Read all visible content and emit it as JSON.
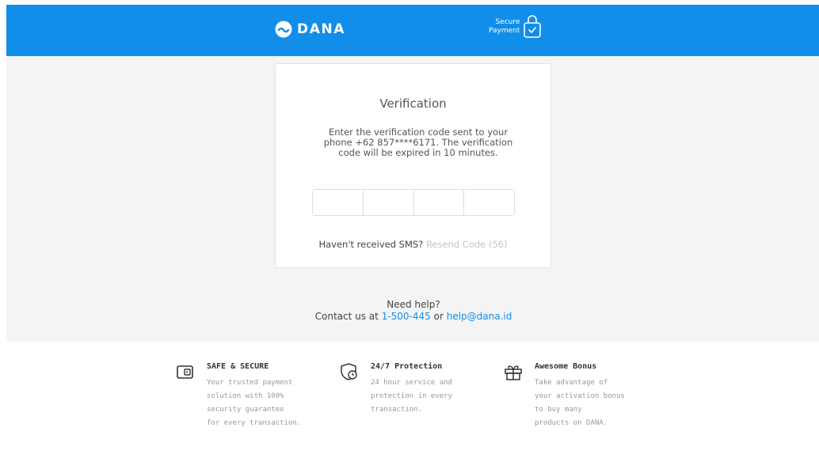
{
  "header": {
    "logo_text": "DANA",
    "secure_line1": "Secure",
    "secure_line2": "Payment",
    "bg_color": "#118eea"
  },
  "verification": {
    "title": "Verification",
    "description": "Enter the verification code sent to your phone +62 857****6171. The verification code will be expired in 10 minutes.",
    "resend_prompt": "Haven't received SMS?",
    "resend_link": "Resend Code (56)"
  },
  "help": {
    "title": "Need help?",
    "contact_prefix": "Contact us at",
    "phone": "1-500-445",
    "or": "or",
    "email": "help@dana.id"
  },
  "features": [
    {
      "icon": "wallet-icon",
      "title": "SAFE & SECURE",
      "lines": [
        "Your trusted payment",
        "solution with 100%",
        "security guarantee",
        "for every transaction."
      ]
    },
    {
      "icon": "shield-clock-icon",
      "title": "24/7 Protection",
      "lines": [
        "24 hour service and",
        "protection in every",
        "transaction."
      ]
    },
    {
      "icon": "gift-icon",
      "title": "Awesome Bonus",
      "lines": [
        "Take advantage of",
        "your activation bonus",
        "to buy many",
        "products on DANA."
      ]
    }
  ]
}
